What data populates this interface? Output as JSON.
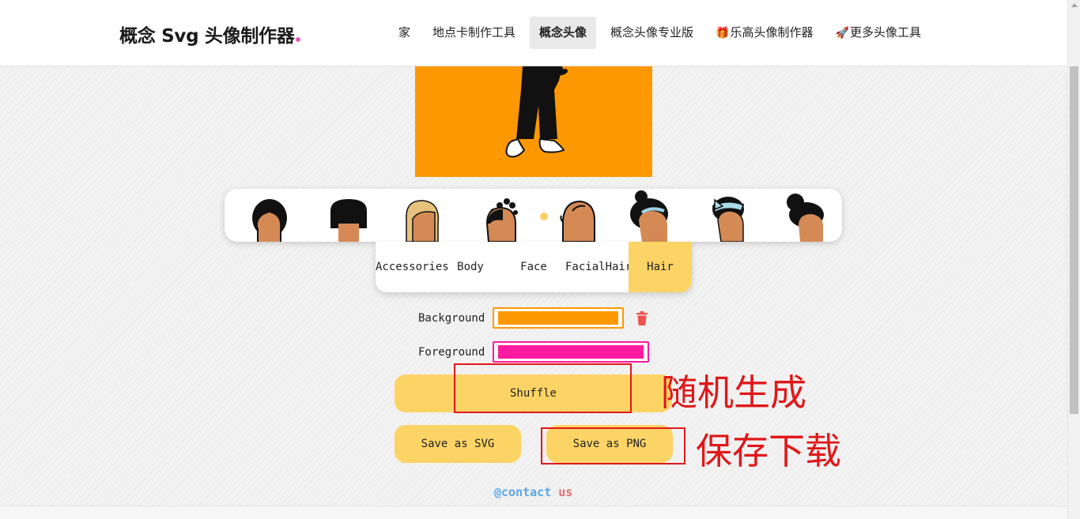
{
  "header": {
    "logo_text": "概念 Svg 头像制作器",
    "nav": [
      {
        "label": "家",
        "icon": ""
      },
      {
        "label": "地点卡制作工具",
        "icon": ""
      },
      {
        "label": "概念头像",
        "icon": ""
      },
      {
        "label": "概念头像专业版",
        "icon": ""
      },
      {
        "label": "乐高头像制作器",
        "icon": "🎁"
      },
      {
        "label": "更多头像工具",
        "icon": "🚀"
      }
    ],
    "active_nav": "概念头像"
  },
  "preview": {
    "background_color": "#fe9802"
  },
  "picker": {
    "option_count": 8,
    "selected_indicator": "dot"
  },
  "tabs": {
    "items": [
      "Accessories",
      "Body",
      "Face",
      "FacialHair",
      "Hair"
    ],
    "active": "Hair"
  },
  "colors": {
    "background_label": "Background",
    "background_value": "#fe9802",
    "foreground_label": "Foreground",
    "foreground_value": "#ff1a9f",
    "delete_icon": "trash-icon"
  },
  "actions": {
    "shuffle_label": "Shuffle",
    "save_svg_label": "Save as SVG",
    "save_png_label": "Save as PNG"
  },
  "annotations": {
    "shuffle_note": "随机生成",
    "save_note": "保存下载",
    "color": "#e0181a"
  },
  "footer": {
    "contact_prefix": "@contact",
    "contact_suffix": " us"
  }
}
